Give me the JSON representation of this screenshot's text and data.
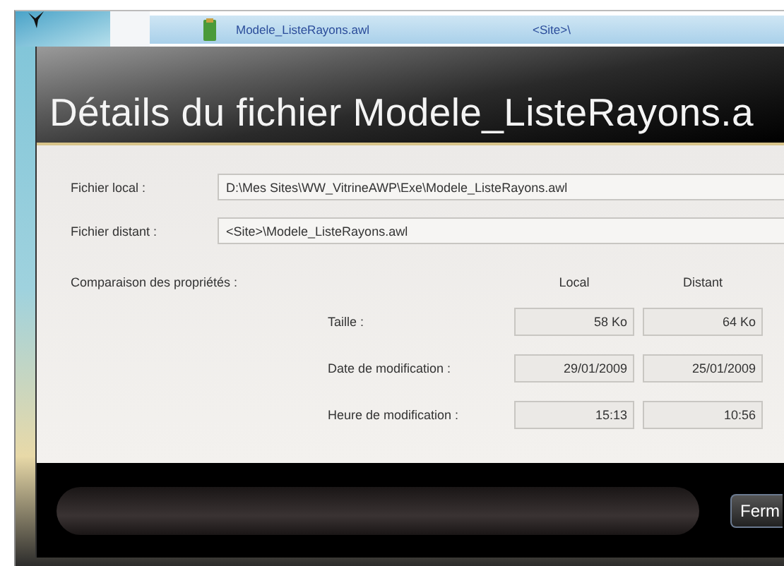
{
  "background_window": {
    "file_name": "Modele_ListeRayons.awl",
    "location": "<Site>\\"
  },
  "dialog": {
    "title": "Détails du fichier Modele_ListeRayons.a",
    "fields": [
      {
        "label": "Fichier local :",
        "value": "D:\\Mes Sites\\WW_VitrineAWP\\Exe\\Modele_ListeRayons.awl"
      },
      {
        "label": "Fichier distant :",
        "value": "<Site>\\Modele_ListeRayons.awl"
      }
    ],
    "comparison": {
      "label": "Comparaison des propriétés :",
      "columns": [
        "Local",
        "Distant"
      ],
      "rows": [
        {
          "label": "Taille :",
          "local": "58 Ko",
          "distant": "64 Ko"
        },
        {
          "label": "Date de modification :",
          "local": "29/01/2009",
          "distant": "25/01/2009"
        },
        {
          "label": "Heure de modification :",
          "local": "15:13",
          "distant": "10:56"
        }
      ]
    },
    "buttons": [
      "Ferm"
    ]
  }
}
